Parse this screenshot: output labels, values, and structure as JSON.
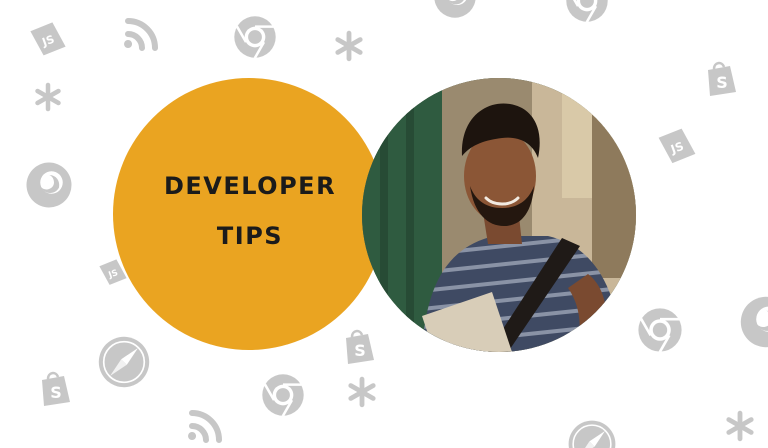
{
  "banner": {
    "title_line1": "DEVELOPER",
    "title_line2": "TIPS"
  },
  "photo": {
    "subject": "smiling man in striped t-shirt reading"
  },
  "colors": {
    "accent": "#eaa421",
    "title_text": "#1b1b1b",
    "icon_gray": "#c7c7c7",
    "background": "#ffffff"
  },
  "background_icons": [
    "js-icon",
    "feed-icon",
    "chrome-icon",
    "asterisk-icon",
    "shopify-bag-icon",
    "firefox-icon",
    "safari-compass-icon"
  ]
}
